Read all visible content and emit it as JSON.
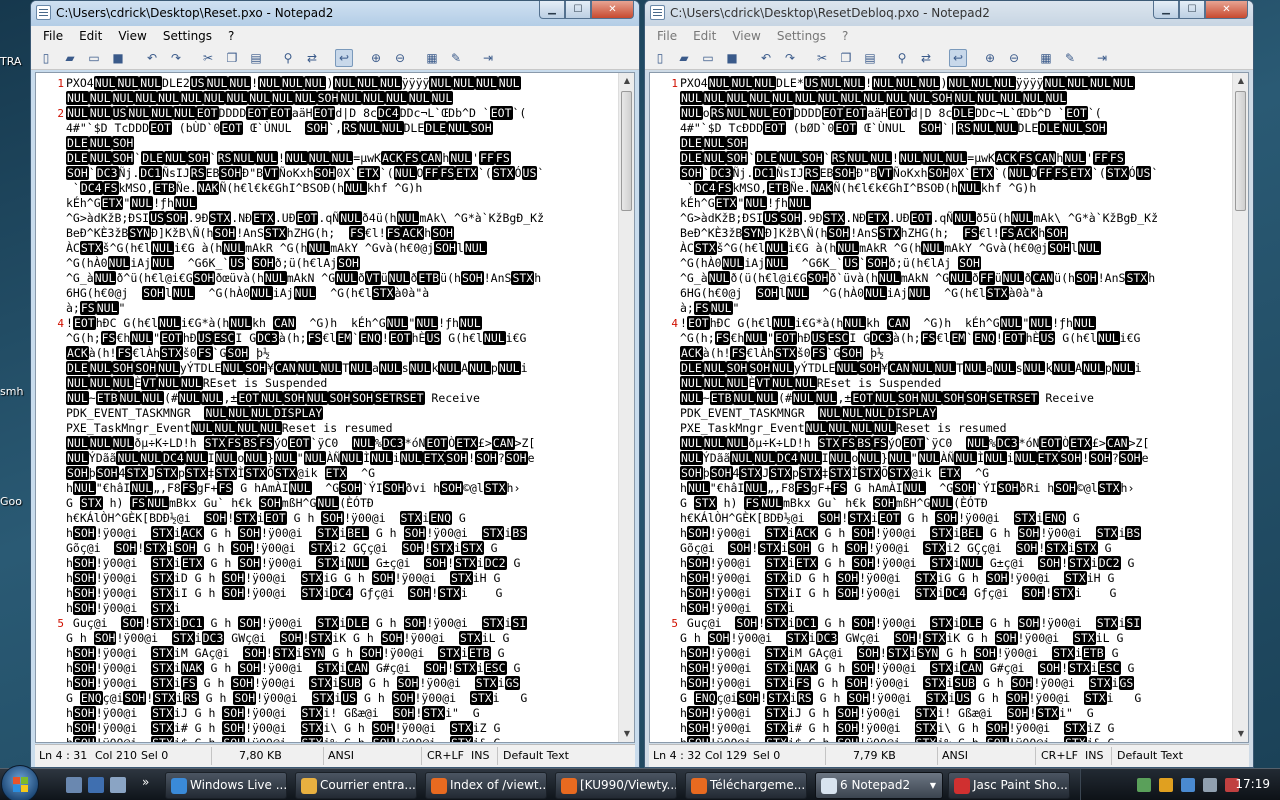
{
  "desktop": {
    "icons": [
      {
        "label": "TRA"
      },
      {
        "label": "smh"
      },
      {
        "label": "Goo"
      }
    ]
  },
  "windows": [
    {
      "title": "C:\\Users\\cdrick\\Desktop\\Reset.pxo - Notepad2",
      "menu": [
        "File",
        "Edit",
        "View",
        "Settings",
        "?"
      ],
      "status": {
        "position": "Ln 4 : 31",
        "col": "Col 210",
        "sel": "Sel 0",
        "size": "7,80 KB",
        "encoding": "ANSI",
        "eol": "CR+LF",
        "mode": "INS",
        "scheme": "Default Text"
      },
      "lines": [
        {
          "n": "1",
          "t": "PXO4[NUL][NUL][NUL]DLE2[US][NUL][NUL]![NUL][NUL][NUL])[NUL][NUL][NUL]ÿÿÿÿ[NUL][NUL][NUL][NUL]"
        },
        {
          "t": "[NUL][NUL][NUL][NUL][NUL][NUL][NUL][NUL][NUL][NUL][NUL][SOH][NUL][NUL][NUL][NUL][NUL]"
        },
        {
          "n": "2",
          "t": "[NUL][NUL][US][NUL][NUL][NUL][EOT]DDDD[EOT][EOT]aäH[EOT]d|D 8c[DC4]DDc¬L`ŒDb^D `[EOT]`("
        },
        {
          "t": "4#\"`$D TcDDD[EOT] (bÙD`0[EOT] Œ`ÙNUL  [SOH]`,[RS][NUL][NUL]DLE[DLE][NUL][SOH]"
        },
        {
          "t": "[DLE][NUL][SOH]"
        },
        {
          "t": "[DLE][NUL][SOH]`[DLE][NUL][SOH]`[RS][NUL][NUL]![NUL][NUL][NUL]=µwK[ACK][FS][CAN]h[NUL]'[FF][FS]"
        },
        {
          "t": "[SOH]`[DC3]Ñj.[DC1]ÑsIJ[RS]EB[SOH]Ð\"B[VT]ÑoKxh[SOH]0X`[ETX]`([NUL]O[FF][FS][ETX]`([STX]Ó[US]`"
        },
        {
          "t": " `[DC4][FS]kMSO,[ETB]Ñe.[NAK]Ñ(h€l€k€GhI^BSOÐ(h[NUL]khf ^G)h"
        },
        {
          "t": "kÉh^G[ETX]\"[NUL]!ƒh[NUL]"
        },
        {
          "t": "^G>àdKžB;ÐSI[US][SOH].9Ð[STX].NÐ[ETX].UÐ[EOT].qÑ[NUL]ð4ü(h[NUL]mAk\\ ^G*à`KžBgÐ_Kž"
        },
        {
          "t": "BeÐ^KÈ3žB[SYN]Ð]KžB\\Ñ(h[SOH]!AnS[STX]hZHG(h;  [FS]€l![FS][ACK]h[SOH]"
        },
        {
          "t": "ÀC[STX]š^G(h€l[NUL]i€G à(h[NUL]mAkR ^G(h[NUL]mAkY ^Gvà(h€0@j[SOH]l[NUL]"
        },
        {
          "t": "^G(hÀ0[NUL]iAj[NUL]  ^G6K_`[US]`[SOH]ð;ü(h€lAj[SOH]"
        },
        {
          "t": "^G_à[NUL]ð^ü(h€l@i€G[SOH]ðœüvà(h[NUL]mAkN ^G[NUL]ð[VT]ü[NUL]ð[ETB]ü(h[SOH]!AnS[STX]h"
        },
        {
          "t": "6HG(h€0@j  [SOH]l[NUL]  ^G(hÀ0[NUL]iAj[NUL]  ^G(h€l[STX]à0à\"à"
        },
        {
          "t": "à;[FS][NUL]\""
        },
        {
          "n": "4",
          "t": "![EOT]hÐC G(h€l[NUL]i€G*à(h[NUL]kh [CAN]  ^G)h  kÉh^G[NUL]\"[NUL]!ƒh[NUL]"
        },
        {
          "t": "^G(h;[FS]€h[NUL]\"[EOT]hÐ[US][ESC]I G[DC3]à(h;[FS]€l[EM]`[ENQ]![EOT]hÈ[US] G(h€l[NUL]i€G"
        },
        {
          "t": "[ACK]à(h![FS]€lÀh[STX]š0[FS]`G[SOH] þ½"
        },
        {
          "t": "[DLE][NUL][SOH][SOH][NUL]yÝTDLE[NUL][SOH]¥[CAN][NUL][NUL]T[NUL]a[NUL]s[NUL]k[NUL]A[NUL]p[NUL]i"
        },
        {
          "t": "[NUL][NUL][NUL]È[VT][NUL][NUL]REset is Suspended"
        },
        {
          "t": "[NUL]~[ETB][NUL][NUL](#[NUL][NUL],±[EOT][NUL][SOH][NUL][SOH][SOH][SETRSET] Receive"
        },
        {
          "t": "PDK_EVENT_TASKMNGR  [NUL][NUL][NUL][DISPLAY]"
        },
        {
          "t": "PXE_TaskMngr_Event[NUL][NUL][NUL][NUL]Reset is resumed"
        },
        {
          "t": "[NUL][NUL][NUL]ðµ÷K÷LD!h [STX][FS][BS][FS]ýO[EOT]`ÿC0  [NUL]%[DC3]*óN[EOT]Ò[ETX]£>[CAN]>Z["
        },
        {
          "t": "[NUL]ÝDãã[NUL][NUL][DC4][NUL]I[NUL]o[NUL]}[NUL]\"[NUL]ÀÑ[NUL]Ì[NUL]i[NUL][ETX][SOH]![SOH]?[SOH]e"
        },
        {
          "t": "[SOH]þ[SOH]4[STX]J[STX]p[STX]‡[STX]Ì[STX]Õ[STX]@ik [ETX]  ^G"
        },
        {
          "t": "h[NUL]\"€hâI[NUL]„,F8[FS]gF+[FS] G hAmÀI[NUL]  ^G[SOH]`ÝI[SOH]ðvi h[SOH]©@l[STX]h›"
        },
        {
          "t": "G [STX] h) [FS][NUL]mBkx Gu` h€k [SOH]mßH^G[NUL](ÈÓTÐ"
        },
        {
          "t": "h€KÁlÒH^GÈK[BDÐ½@i  [SOH]![STX]i[EOT] G h [SOH]!ÿ00@i  [STX]i[ENQ] G"
        },
        {
          "t": "h[SOH]!ÿ00@i  [STX]i[ACK] G h [SOH]!ÿ00@i  [STX]i[BEL] G h [SOH]!ÿ00@i  [STX]i[BS]"
        },
        {
          "t": "Gõç@i  [SOH]![STX]i[SOH] G h [SOH]!ÿ00@i  [STX]i2 GÇç@i  [SOH]![STX]i[STX] G"
        },
        {
          "t": "h[SOH]!ÿ00@i  [STX]i[ETX] G h [SOH]!ÿ00@i  [STX]i[NUL] G±ç@i  [SOH]![STX]i[DC2] G"
        },
        {
          "t": "h[SOH]!ÿ00@i  [STX]iD G h [SOH]!ÿ00@i  [STX]iG G h [SOH]!ÿ00@i  [STX]iH G"
        },
        {
          "t": "h[SOH]!ÿ00@i  [STX]iI G h [SOH]!ÿ00@i  [STX]i[DC4] Gƒç@i  [SOH]![STX]i    G"
        },
        {
          "t": "h[SOH]!ÿ00@i  [STX]i"
        },
        {
          "n": "5",
          "t": " Guç@i  [SOH]![STX]i[DC1] G h [SOH]!ÿ00@i  [STX]i[DLE] G h [SOH]!ÿ00@i  [STX]i[SI]"
        },
        {
          "t": "G h [SOH]!ÿ00@i  [STX]i[DC3] GWç@i  [SOH]![STX]iK G h [SOH]!ÿ00@i  [STX]iL G"
        },
        {
          "t": "h[SOH]!ÿ00@i  [STX]iM GAç@i  [SOH]![STX]i[SYN] G h [SOH]!ÿ00@i  [STX]i[ETB] G"
        },
        {
          "t": "h[SOH]!ÿ00@i  [STX]i[NAK] G h [SOH]!ÿ00@i  [STX]i[CAN] G#ç@i  [SOH]![STX]i[ESC] G"
        },
        {
          "t": "h[SOH]!ÿ00@i  [STX]i[FS] G h [SOH]!ÿ00@i  [STX]i[SUB] G h [SOH]!ÿ00@i  [STX]i[GS]"
        },
        {
          "t": "G [ENQ]ç@i[SOH]![STX]i[RS] G h [SOH]!ÿ00@i  [STX]i[US] G h [SOH]!ÿ00@i  [STX]i   G"
        },
        {
          "t": "h[SOH]!ÿ00@i  [STX]iJ G h [SOH]!ÿ00@i  [STX]i! Gßæ@i  [SOH]![STX]i\"  G"
        },
        {
          "t": "h[SOH]!ÿ00@i  [STX]i# G h [SOH]!ÿ00@i  [STX]i\\ G h [SOH]!ÿ00@i  [STX]iZ G"
        },
        {
          "t": "h[SOH]!ÿ00@i  [STX]i$ G h [SOH]!ÿ00@i  [STX]i% G h [SOH]!ÿ00@i  [STX]i& G"
        }
      ]
    },
    {
      "title": "C:\\Users\\cdrick\\Desktop\\ResetDebloq.pxo - Notepad2",
      "menu": [
        "File",
        "Edit",
        "View",
        "Settings",
        "?"
      ],
      "status": {
        "position": "Ln 4 : 32",
        "col": "Col 129",
        "sel": "Sel 0",
        "size": "7,79 KB",
        "encoding": "ANSI",
        "eol": "CR+LF",
        "mode": "INS",
        "scheme": "Default Text"
      },
      "lines": [
        {
          "n": "1",
          "t": "PXO4[NUL][NUL][NUL]DLE*[US][NUL][NUL]![NUL][NUL][NUL])[NUL][NUL][NUL]ÿÿÿÿ[NUL][NUL][NUL][NUL]"
        },
        {
          "t": "[NUL][NUL][NUL][NUL][NUL][NUL][NUL][NUL][NUL][NUL][NUL][SOH][NUL][NUL][NUL][NUL][NUL]"
        },
        {
          "t": "[NUL]o[RS][NUL][NUL][EOT]DDDD[EOT][EOT]aäH[EOT]d|D 8c[DLE]DDc¬L`ŒDb^D `[EOT]`("
        },
        {
          "t": "4#\"`$D TcÐDD[EOT] (bØD`0[EOT] Œ`ÙNUL  [SOH]`|[RS][NUL][NUL]DLE[DLE][NUL][SOH]"
        },
        {
          "t": "[DLE][NUL][SOH]"
        },
        {
          "t": "[DLE][NUL][SOH]`[DLE][NUL][SOH]`[RS][NUL][NUL]![NUL][NUL][NUL]=µwK[ACK][FS][CAN]h[NUL]'[FF][FS]"
        },
        {
          "t": "[SOH]`[DC3]Ñj.[DC1]ÑsIJ[RS]EB[SOH]Ð\"B[VT]ÑoKxh[SOH]0X`[ETX]`([NUL]O[FF][FS][ETX]`([STX]Ó[US]`"
        },
        {
          "t": " `[DC4][FS]kMSO,[ETB]Ñe.[NAK]Ñ(h€l€k€GhI^BSOÐ(h[NUL]khf ^G)h"
        },
        {
          "t": "kÉh^G[ETX]\"[NUL]!ƒh[NUL]"
        },
        {
          "t": "^G>àdKžB;ÐSI[US][SOH].9Ð[STX].NÐ[ETX].UÐ[EOT].qÑ[NUL]ð5ü(h[NUL]mAk\\ ^G*à`KžBgÐ_Kž"
        },
        {
          "t": "BeÐ^KÈ3žB[SYN]Ð]KžB\\Ñ(h[SOH]!AnS[STX]hZHG(h;  [FS]€l![FS][ACK]h[SOH]"
        },
        {
          "t": "ÀC[STX]š^G(h€l[NUL]i€G à(h[NUL]mAkR ^G(h[NUL]mAkY ^Gvà(h€0@j[SOH]l[NUL]"
        },
        {
          "t": "^G(hÀ0[NUL]iAj[NUL]  ^G6K_`[US]`[SOH]ð;ü(h€lAj [SOH]"
        },
        {
          "t": "^G_à[NUL]ð(ü(h€l@i€G[SOH]ð`üvà(h[NUL]mAkN ^G[NUL]ð[FF]ü[NUL]ð[CAN]ü(h[SOH]!AnS[STX]h"
        },
        {
          "t": "6HG(h€0@j  [SOH]l[NUL]  ^G(hÀ0[NUL]iAj[NUL]  ^G(h€l[STX]à0à\"à"
        },
        {
          "t": "à;[FS][NUL]\""
        },
        {
          "n": "4",
          "t": "![EOT]hÐC G(h€l[NUL]i€G*à(h[NUL]kh [CAN]  ^G)h  kÉh^G[NUL]\"[NUL]!ƒh[NUL]"
        },
        {
          "t": "^G(h;[FS]€h[NUL]\"[EOT]hÐ[US][ESC]I G[DC3]à(h;[FS]€l[EM]`[ENQ]![EOT]hÈ[US] G(h€l[NUL]i€G"
        },
        {
          "t": "[ACK]à(h![FS]€lÀh[STX]š0[FS]`G[SOH] þ½"
        },
        {
          "t": "[DLE][NUL][SOH][SOH][NUL]yÝTDLE[NUL][SOH]¥[CAN][NUL][NUL]T[NUL]a[NUL]s[NUL]k[NUL]A[NUL]p[NUL]i"
        },
        {
          "t": "[NUL][NUL][NUL]È[VT][NUL][NUL]REset is Suspended"
        },
        {
          "t": "[NUL]~[ETB][NUL][NUL](#[NUL][NUL],±[EOT][NUL][SOH][NUL][SOH][SOH][SETRSET] Receive"
        },
        {
          "t": "PDK_EVENT_TASKMNGR  [NUL][NUL][NUL][DISPLAY]"
        },
        {
          "t": "PXE_TaskMngr_Event[NUL][NUL][NUL][NUL]Reset is resumed"
        },
        {
          "t": "[NUL][NUL][NUL]ðµ÷K÷LD!h [STX][FS][BS][FS]ýO[EOT]`ÿC0  [NUL]%[DC3]*óN[EOT]Ò[ETX]£>[CAN]>Z["
        },
        {
          "t": "[NUL]ÝDãã[NUL][NUL][DC4][NUL]I[NUL]o[NUL]}[NUL]\"[NUL]ÀÑ[NUL]Ì[NUL]i[NUL][ETX][SOH]![SOH]?[SOH]e"
        },
        {
          "t": "[SOH]þ[SOH]4[STX]J[STX]p[STX]‡[STX]Ì[STX]Õ[STX]@ik [ETX]  ^G"
        },
        {
          "t": "h[NUL]\"€hâI[NUL]„,F8[FS]gF+[FS] G hAmÀI[NUL]  ^G[SOH]`ÝI[SOH]ðRi h[SOH]©@l[STX]h›"
        },
        {
          "t": "G [STX] h) [FS][NUL]mBkx Gu` h€k [SOH]mßH^G[NUL](ÈÓTÐ"
        },
        {
          "t": "h€KÁlÒH^GÈK[BDÐ½@i  [SOH]![STX]i[EOT] G h [SOH]!ÿ00@i  [STX]i[ENQ] G"
        },
        {
          "t": "h[SOH]!ÿ00@i  [STX]i[ACK] G h [SOH]!ÿ00@i  [STX]i[BEL] G h [SOH]!ÿ00@i  [STX]i[BS]"
        },
        {
          "t": "Gõç@i  [SOH]![STX]i[SOH] G h [SOH]!ÿ00@i  [STX]i2 GÇç@i  [SOH]![STX]i[STX] G"
        },
        {
          "t": "h[SOH]!ÿ00@i  [STX]i[ETX] G h [SOH]!ÿ00@i  [STX]i[NUL] G±ç@i  [SOH]![STX]i[DC2] G"
        },
        {
          "t": "h[SOH]!ÿ00@i  [STX]iD G h [SOH]!ÿ00@i  [STX]iG G h [SOH]!ÿ00@i  [STX]iH G"
        },
        {
          "t": "h[SOH]!ÿ00@i  [STX]iI G h [SOH]!ÿ00@i  [STX]i[DC4] Gƒç@i  [SOH]![STX]i    G"
        },
        {
          "t": "h[SOH]!ÿ00@i  [STX]i"
        },
        {
          "n": "5",
          "t": " Guç@i  [SOH]![STX]i[DC1] G h [SOH]!ÿ00@i  [STX]i[DLE] G h [SOH]!ÿ00@i  [STX]i[SI]"
        },
        {
          "t": "G h [SOH]!ÿ00@i  [STX]i[DC3] GWç@i  [SOH]![STX]iK G h [SOH]!ÿ00@i  [STX]iL G"
        },
        {
          "t": "h[SOH]!ÿ00@i  [STX]iM GAç@i  [SOH]![STX]i[SYN] G h [SOH]!ÿ00@i  [STX]i[ETB] G"
        },
        {
          "t": "h[SOH]!ÿ00@i  [STX]i[NAK] G h [SOH]!ÿ00@i  [STX]i[CAN] G#ç@i  [SOH]![STX]i[ESC] G"
        },
        {
          "t": "h[SOH]!ÿ00@i  [STX]i[FS] G h [SOH]!ÿ00@i  [STX]i[SUB] G h [SOH]!ÿ00@i  [STX]i[GS]"
        },
        {
          "t": "G [ENQ]ç@i[SOH]![STX]i[RS] G h [SOH]!ÿ00@i  [STX]i[US] G h [SOH]!ÿ00@i  [STX]i   G"
        },
        {
          "t": "h[SOH]!ÿ00@i  [STX]iJ G h [SOH]!ÿ00@i  [STX]i! Gßæ@i  [SOH]![STX]i\"  G"
        },
        {
          "t": "h[SOH]!ÿ00@i  [STX]i# G h [SOH]!ÿ00@i  [STX]i\\ G h [SOH]!ÿ00@i  [STX]iZ G"
        },
        {
          "t": "h[SOH]!ÿ00@i  [STX]i$ G h [SOH]!ÿ00@i  [STX]i% G h [SOH]!ÿ00@i  [STX]i& G"
        }
      ]
    }
  ],
  "taskbar": {
    "tasks": [
      {
        "label": "Windows Live ...",
        "icon": "windows-live-icon",
        "color": "#3a8ad8"
      },
      {
        "label": "Courrier entra...",
        "icon": "mail-icon",
        "color": "#e8b040"
      },
      {
        "label": "Index of /viewt...",
        "icon": "firefox-icon",
        "color": "#e86a20"
      },
      {
        "label": "[KU990/Viewty...",
        "icon": "firefox-icon",
        "color": "#e86a20"
      },
      {
        "label": "Téléchargeme...",
        "icon": "firefox-icon",
        "color": "#e86a20"
      },
      {
        "label": "6 Notepad2",
        "icon": "notepad-icon",
        "color": "#d8e4f0"
      },
      {
        "label": "Jasc Paint Sho...",
        "icon": "paint-shop-icon",
        "color": "#d03030"
      }
    ],
    "clock": "17:19"
  },
  "colors": {
    "accent": "#d01000",
    "ctrl_bg": "#000000",
    "ctrl_fg": "#ffffff"
  }
}
